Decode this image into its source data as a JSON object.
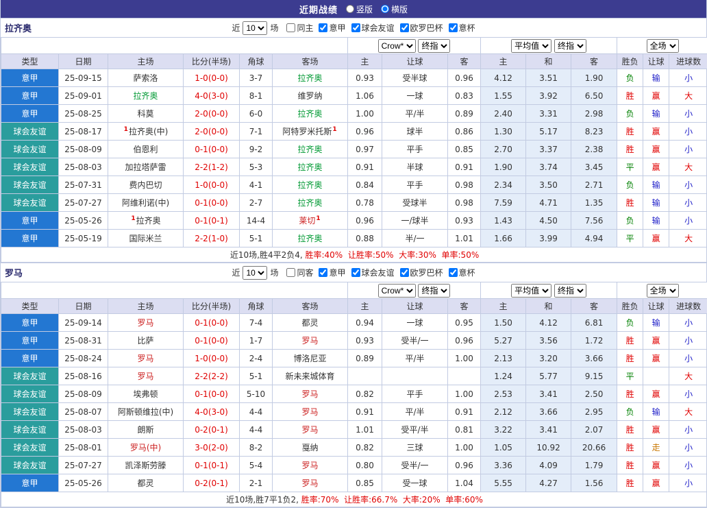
{
  "header": {
    "title": "近期战绩",
    "radio_vertical": "竖版",
    "radio_horizontal": "横版",
    "selected_layout": "横版"
  },
  "controls": {
    "near_label": "近",
    "count_option": "10",
    "matches_label": "场",
    "bookmaker": "Crow*",
    "final_odds": "终指",
    "average": "平均值",
    "scope": "全场"
  },
  "columns": [
    "类型",
    "日期",
    "主场",
    "比分(半场)",
    "角球",
    "客场",
    "主",
    "让球",
    "客",
    "主",
    "和",
    "客",
    "胜负",
    "让球",
    "进球数"
  ],
  "palette": {
    "topbar_bg": "#3C3C90",
    "league_colors": {
      "serie_a": "#2377D2",
      "friendly": "#2A9D9D"
    },
    "name_colors": {
      "green": "#009933",
      "red": "#CC2222",
      "black": "#333333"
    },
    "mark_colors": {
      "r": "#E00000",
      "g": "#008000",
      "b": "#1D1DC8",
      "o": "#C97700"
    },
    "score_color": "#E00000",
    "card_color": "#E00000",
    "header_bg": "#DCDEF2",
    "avg_col_bg": "#E4EDF9",
    "grid_border": "#C2CBE2"
  },
  "sections": [
    {
      "team": "拉齐奥",
      "filters": [
        {
          "key": "same-venue",
          "label": "同主",
          "checked": false
        },
        {
          "key": "serie-a",
          "label": "意甲",
          "checked": true
        },
        {
          "key": "club-friendly",
          "label": "球会友谊",
          "checked": true
        },
        {
          "key": "europa-league",
          "label": "欧罗巴杯",
          "checked": true
        },
        {
          "key": "coppa-italia",
          "label": "意杯",
          "checked": true
        }
      ],
      "rows": [
        {
          "league": "意甲",
          "lk": "serie_a",
          "date": "25-09-15",
          "home": {
            "n": "萨索洛",
            "c": "black"
          },
          "score": "1-0(0-0)",
          "corners": "3-7",
          "away": {
            "n": "拉齐奥",
            "c": "green"
          },
          "odds": [
            "0.93",
            "受半球",
            "0.96"
          ],
          "avg": [
            "4.12",
            "3.51",
            "1.90"
          ],
          "res": [
            "负",
            "g"
          ],
          "hres": [
            "输",
            "b"
          ],
          "gres": [
            "小",
            "b"
          ]
        },
        {
          "league": "意甲",
          "lk": "serie_a",
          "date": "25-09-01",
          "home": {
            "n": "拉齐奥",
            "c": "green"
          },
          "score": "4-0(3-0)",
          "corners": "8-1",
          "away": {
            "n": "维罗纳",
            "c": "black"
          },
          "odds": [
            "1.06",
            "一球",
            "0.83"
          ],
          "avg": [
            "1.55",
            "3.92",
            "6.50"
          ],
          "res": [
            "胜",
            "r"
          ],
          "hres": [
            "赢",
            "r"
          ],
          "gres": [
            "大",
            "r"
          ]
        },
        {
          "league": "意甲",
          "lk": "serie_a",
          "date": "25-08-25",
          "home": {
            "n": "科莫",
            "c": "black"
          },
          "score": "2-0(0-0)",
          "corners": "6-0",
          "away": {
            "n": "拉齐奥",
            "c": "green"
          },
          "odds": [
            "1.00",
            "平/半",
            "0.89"
          ],
          "avg": [
            "2.40",
            "3.31",
            "2.98"
          ],
          "res": [
            "负",
            "g"
          ],
          "hres": [
            "输",
            "b"
          ],
          "gres": [
            "小",
            "b"
          ]
        },
        {
          "league": "球会友谊",
          "lk": "friendly",
          "date": "25-08-17",
          "home": {
            "pre": "1",
            "n": "拉齐奥(中)",
            "c": "black"
          },
          "score": "2-0(0-0)",
          "corners": "7-1",
          "away": {
            "n": "阿特罗米托斯",
            "c": "black",
            "post": "1"
          },
          "odds": [
            "0.96",
            "球半",
            "0.86"
          ],
          "avg": [
            "1.30",
            "5.17",
            "8.23"
          ],
          "res": [
            "胜",
            "r"
          ],
          "hres": [
            "赢",
            "r"
          ],
          "gres": [
            "小",
            "b"
          ]
        },
        {
          "league": "球会友谊",
          "lk": "friendly",
          "date": "25-08-09",
          "home": {
            "n": "伯恩利",
            "c": "black"
          },
          "score": "0-1(0-0)",
          "corners": "9-2",
          "away": {
            "n": "拉齐奥",
            "c": "green"
          },
          "odds": [
            "0.97",
            "平手",
            "0.85"
          ],
          "avg": [
            "2.70",
            "3.37",
            "2.38"
          ],
          "res": [
            "胜",
            "r"
          ],
          "hres": [
            "赢",
            "r"
          ],
          "gres": [
            "小",
            "b"
          ]
        },
        {
          "league": "球会友谊",
          "lk": "friendly",
          "date": "25-08-03",
          "home": {
            "n": "加拉塔萨雷",
            "c": "black"
          },
          "score": "2-2(1-2)",
          "corners": "5-3",
          "away": {
            "n": "拉齐奥",
            "c": "green"
          },
          "odds": [
            "0.91",
            "半球",
            "0.91"
          ],
          "avg": [
            "1.90",
            "3.74",
            "3.45"
          ],
          "res": [
            "平",
            "g"
          ],
          "hres": [
            "赢",
            "r"
          ],
          "gres": [
            "大",
            "r"
          ]
        },
        {
          "league": "球会友谊",
          "lk": "friendly",
          "date": "25-07-31",
          "home": {
            "n": "费内巴切",
            "c": "black"
          },
          "score": "1-0(0-0)",
          "corners": "4-1",
          "away": {
            "n": "拉齐奥",
            "c": "green"
          },
          "odds": [
            "0.84",
            "平手",
            "0.98"
          ],
          "avg": [
            "2.34",
            "3.50",
            "2.71"
          ],
          "res": [
            "负",
            "g"
          ],
          "hres": [
            "输",
            "b"
          ],
          "gres": [
            "小",
            "b"
          ]
        },
        {
          "league": "球会友谊",
          "lk": "friendly",
          "date": "25-07-27",
          "home": {
            "n": "阿维利诺(中)",
            "c": "black"
          },
          "score": "0-1(0-0)",
          "corners": "2-7",
          "away": {
            "n": "拉齐奥",
            "c": "green"
          },
          "odds": [
            "0.78",
            "受球半",
            "0.98"
          ],
          "avg": [
            "7.59",
            "4.71",
            "1.35"
          ],
          "res": [
            "胜",
            "r"
          ],
          "hres": [
            "输",
            "b"
          ],
          "gres": [
            "小",
            "b"
          ]
        },
        {
          "league": "意甲",
          "lk": "serie_a",
          "date": "25-05-26",
          "home": {
            "pre": "1",
            "n": "拉齐奥",
            "c": "black"
          },
          "score": "0-1(0-1)",
          "corners": "14-4",
          "away": {
            "n": "莱切",
            "c": "red",
            "post": "1"
          },
          "odds": [
            "0.96",
            "一/球半",
            "0.93"
          ],
          "avg": [
            "1.43",
            "4.50",
            "7.56"
          ],
          "res": [
            "负",
            "g"
          ],
          "hres": [
            "输",
            "b"
          ],
          "gres": [
            "小",
            "b"
          ]
        },
        {
          "league": "意甲",
          "lk": "serie_a",
          "date": "25-05-19",
          "home": {
            "n": "国际米兰",
            "c": "black"
          },
          "score": "2-2(1-0)",
          "corners": "5-1",
          "away": {
            "n": "拉齐奥",
            "c": "green"
          },
          "odds": [
            "0.88",
            "半/一",
            "1.01"
          ],
          "avg": [
            "1.66",
            "3.99",
            "4.94"
          ],
          "res": [
            "平",
            "g"
          ],
          "hres": [
            "赢",
            "r"
          ],
          "gres": [
            "大",
            "r"
          ]
        }
      ],
      "summary_prefix": "近10场,胜4平2负4, ",
      "summary_stats": "胜率:40%  让胜率:50%  大率:30%  单率:50%"
    },
    {
      "team": "罗马",
      "filters": [
        {
          "key": "same-venue",
          "label": "同客",
          "checked": false
        },
        {
          "key": "serie-a",
          "label": "意甲",
          "checked": true
        },
        {
          "key": "club-friendly",
          "label": "球会友谊",
          "checked": true
        },
        {
          "key": "europa-league",
          "label": "欧罗巴杯",
          "checked": true
        },
        {
          "key": "coppa-italia",
          "label": "意杯",
          "checked": true
        }
      ],
      "rows": [
        {
          "league": "意甲",
          "lk": "serie_a",
          "date": "25-09-14",
          "home": {
            "n": "罗马",
            "c": "red"
          },
          "score": "0-1(0-0)",
          "corners": "7-4",
          "away": {
            "n": "都灵",
            "c": "black"
          },
          "odds": [
            "0.94",
            "一球",
            "0.95"
          ],
          "avg": [
            "1.50",
            "4.12",
            "6.81"
          ],
          "res": [
            "负",
            "g"
          ],
          "hres": [
            "输",
            "b"
          ],
          "gres": [
            "小",
            "b"
          ]
        },
        {
          "league": "意甲",
          "lk": "serie_a",
          "date": "25-08-31",
          "home": {
            "n": "比萨",
            "c": "black"
          },
          "score": "0-1(0-0)",
          "corners": "1-7",
          "away": {
            "n": "罗马",
            "c": "red"
          },
          "odds": [
            "0.93",
            "受半/一",
            "0.96"
          ],
          "avg": [
            "5.27",
            "3.56",
            "1.72"
          ],
          "res": [
            "胜",
            "r"
          ],
          "hres": [
            "赢",
            "r"
          ],
          "gres": [
            "小",
            "b"
          ]
        },
        {
          "league": "意甲",
          "lk": "serie_a",
          "date": "25-08-24",
          "home": {
            "n": "罗马",
            "c": "red"
          },
          "score": "1-0(0-0)",
          "corners": "2-4",
          "away": {
            "n": "博洛尼亚",
            "c": "black"
          },
          "odds": [
            "0.89",
            "平/半",
            "1.00"
          ],
          "avg": [
            "2.13",
            "3.20",
            "3.66"
          ],
          "res": [
            "胜",
            "r"
          ],
          "hres": [
            "赢",
            "r"
          ],
          "gres": [
            "小",
            "b"
          ]
        },
        {
          "league": "球会友谊",
          "lk": "friendly",
          "date": "25-08-16",
          "home": {
            "n": "罗马",
            "c": "red"
          },
          "score": "2-2(2-2)",
          "corners": "5-1",
          "away": {
            "n": "新未来城体育",
            "c": "black"
          },
          "odds": [
            "",
            "",
            ""
          ],
          "avg": [
            "1.24",
            "5.77",
            "9.15"
          ],
          "res": [
            "平",
            "g"
          ],
          "hres": [
            "",
            ""
          ],
          "gres": [
            "大",
            "r"
          ]
        },
        {
          "league": "球会友谊",
          "lk": "friendly",
          "date": "25-08-09",
          "home": {
            "n": "埃弗顿",
            "c": "black"
          },
          "score": "0-1(0-0)",
          "corners": "5-10",
          "away": {
            "n": "罗马",
            "c": "red"
          },
          "odds": [
            "0.82",
            "平手",
            "1.00"
          ],
          "avg": [
            "2.53",
            "3.41",
            "2.50"
          ],
          "res": [
            "胜",
            "r"
          ],
          "hres": [
            "赢",
            "r"
          ],
          "gres": [
            "小",
            "b"
          ]
        },
        {
          "league": "球会友谊",
          "lk": "friendly",
          "date": "25-08-07",
          "home": {
            "n": "阿斯顿维拉(中)",
            "c": "black"
          },
          "score": "4-0(3-0)",
          "corners": "4-4",
          "away": {
            "n": "罗马",
            "c": "red"
          },
          "odds": [
            "0.91",
            "平/半",
            "0.91"
          ],
          "avg": [
            "2.12",
            "3.66",
            "2.95"
          ],
          "res": [
            "负",
            "g"
          ],
          "hres": [
            "输",
            "b"
          ],
          "gres": [
            "大",
            "r"
          ]
        },
        {
          "league": "球会友谊",
          "lk": "friendly",
          "date": "25-08-03",
          "home": {
            "n": "朗斯",
            "c": "black"
          },
          "score": "0-2(0-1)",
          "corners": "4-4",
          "away": {
            "n": "罗马",
            "c": "red"
          },
          "odds": [
            "1.01",
            "受平/半",
            "0.81"
          ],
          "avg": [
            "3.22",
            "3.41",
            "2.07"
          ],
          "res": [
            "胜",
            "r"
          ],
          "hres": [
            "赢",
            "r"
          ],
          "gres": [
            "小",
            "b"
          ]
        },
        {
          "league": "球会友谊",
          "lk": "friendly",
          "date": "25-08-01",
          "home": {
            "n": "罗马(中)",
            "c": "red"
          },
          "score": "3-0(2-0)",
          "corners": "8-2",
          "away": {
            "n": "戛纳",
            "c": "black"
          },
          "odds": [
            "0.82",
            "三球",
            "1.00"
          ],
          "avg": [
            "1.05",
            "10.92",
            "20.66"
          ],
          "res": [
            "胜",
            "r"
          ],
          "hres": [
            "走",
            "o"
          ],
          "gres": [
            "小",
            "b"
          ]
        },
        {
          "league": "球会友谊",
          "lk": "friendly",
          "date": "25-07-27",
          "home": {
            "n": "凯泽斯劳滕",
            "c": "black"
          },
          "score": "0-1(0-1)",
          "corners": "5-4",
          "away": {
            "n": "罗马",
            "c": "red"
          },
          "odds": [
            "0.80",
            "受半/一",
            "0.96"
          ],
          "avg": [
            "3.36",
            "4.09",
            "1.79"
          ],
          "res": [
            "胜",
            "r"
          ],
          "hres": [
            "赢",
            "r"
          ],
          "gres": [
            "小",
            "b"
          ]
        },
        {
          "league": "意甲",
          "lk": "serie_a",
          "date": "25-05-26",
          "home": {
            "n": "都灵",
            "c": "black"
          },
          "score": "0-2(0-1)",
          "corners": "2-1",
          "away": {
            "n": "罗马",
            "c": "red"
          },
          "odds": [
            "0.85",
            "受一球",
            "1.04"
          ],
          "avg": [
            "5.55",
            "4.27",
            "1.56"
          ],
          "res": [
            "胜",
            "r"
          ],
          "hres": [
            "赢",
            "r"
          ],
          "gres": [
            "小",
            "b"
          ]
        }
      ],
      "summary_prefix": "近10场,胜7平1负2, ",
      "summary_stats": "胜率:70%  让胜率:66.7%  大率:20%  单率:60%"
    }
  ]
}
